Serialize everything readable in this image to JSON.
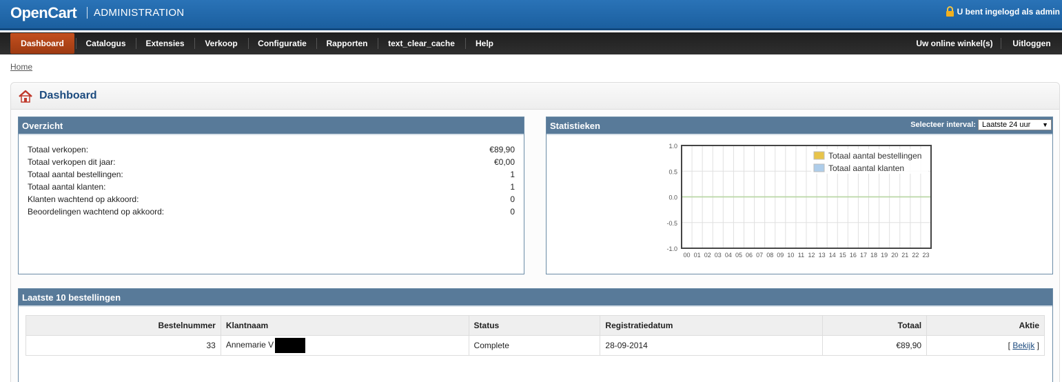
{
  "header": {
    "logo": "OpenCart",
    "subtitle": "ADMINISTRATION",
    "login_text": "U bent ingelogd als admin"
  },
  "menu": {
    "items": [
      "Dashboard",
      "Catalogus",
      "Extensies",
      "Verkoop",
      "Configuratie",
      "Rapporten",
      "text_clear_cache",
      "Help"
    ],
    "right": [
      "Uw online winkel(s)",
      "Uitloggen"
    ],
    "active": "Dashboard"
  },
  "breadcrumb": "Home",
  "page_title": "Dashboard",
  "overview": {
    "title": "Overzicht",
    "rows": [
      {
        "label": "Totaal verkopen:",
        "value": "€89,90"
      },
      {
        "label": "Totaal verkopen dit jaar:",
        "value": "€0,00"
      },
      {
        "label": "Totaal aantal bestellingen:",
        "value": "1"
      },
      {
        "label": "Totaal aantal klanten:",
        "value": "1"
      },
      {
        "label": "Klanten wachtend op akkoord:",
        "value": "0"
      },
      {
        "label": "Beoordelingen wachtend op akkoord:",
        "value": "0"
      }
    ]
  },
  "statistics": {
    "title": "Statistieken",
    "interval_label": "Selecteer interval:",
    "interval_value": "Laatste 24 uur"
  },
  "chart_data": {
    "type": "line",
    "x": [
      "00",
      "01",
      "02",
      "03",
      "04",
      "05",
      "06",
      "07",
      "08",
      "09",
      "10",
      "11",
      "12",
      "13",
      "14",
      "15",
      "16",
      "17",
      "18",
      "19",
      "20",
      "21",
      "22",
      "23"
    ],
    "series": [
      {
        "name": "Totaal aantal bestellingen",
        "values": [
          0,
          0,
          0,
          0,
          0,
          0,
          0,
          0,
          0,
          0,
          0,
          0,
          0,
          0,
          0,
          0,
          0,
          0,
          0,
          0,
          0,
          0,
          0,
          0
        ],
        "color": "#e8c44a"
      },
      {
        "name": "Totaal aantal klanten",
        "values": [
          0,
          0,
          0,
          0,
          0,
          0,
          0,
          0,
          0,
          0,
          0,
          0,
          0,
          0,
          0,
          0,
          0,
          0,
          0,
          0,
          0,
          0,
          0,
          0
        ],
        "color": "#aecdea"
      }
    ],
    "yticks": [
      "1.0",
      "0.5",
      "0.0",
      "-0.5",
      "-1.0"
    ],
    "ylim": [
      -1,
      1
    ],
    "grid": true,
    "legend": "top-right"
  },
  "orders": {
    "title": "Laatste 10 bestellingen",
    "columns": [
      "Bestelnummer",
      "Klantnaam",
      "Status",
      "Registratiedatum",
      "Totaal",
      "Aktie"
    ],
    "rows": [
      {
        "id": "33",
        "customer": "Annemarie V",
        "status": "Complete",
        "date": "28-09-2014",
        "total": "€89,90",
        "action": "Bekijk"
      }
    ]
  },
  "colors": {
    "header_blue": "#1b5f9f",
    "menu_active": "#c4501e",
    "panel_head": "#587a99",
    "title_blue": "#1c4b7f"
  }
}
